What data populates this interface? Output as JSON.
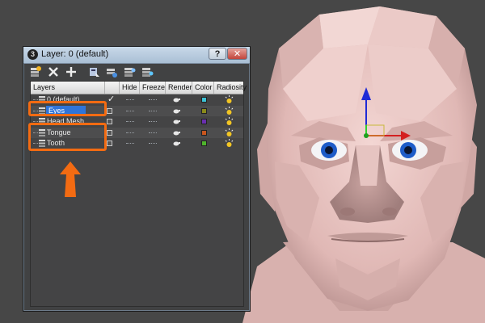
{
  "window": {
    "title": "Layer: 0 (default)",
    "help_label": "?",
    "close_label": "✕"
  },
  "toolbar": [
    {
      "name": "create-layer-icon"
    },
    {
      "name": "delete-layer-icon"
    },
    {
      "name": "add-to-layer-icon"
    },
    {
      "name": "select-in-layer-icon"
    },
    {
      "name": "highlight-layer-icon"
    },
    {
      "name": "hide-all-layers-icon"
    },
    {
      "name": "freeze-all-layers-icon"
    }
  ],
  "columns": [
    "Layers",
    "",
    "Hide",
    "Freeze",
    "Render",
    "Color",
    "Radiosity"
  ],
  "layers": [
    {
      "name": "0 (default)",
      "active": true,
      "selected": false,
      "color": "#3cc3d6"
    },
    {
      "name": "Eyes",
      "active": false,
      "selected": true,
      "color": "#8a8a1a"
    },
    {
      "name": "Head Mesh",
      "active": false,
      "selected": false,
      "color": "#6a2fb0"
    },
    {
      "name": "Tongue",
      "active": false,
      "selected": false,
      "color": "#c8561e"
    },
    {
      "name": "Tooth",
      "active": false,
      "selected": false,
      "color": "#4fb52c"
    }
  ],
  "colors": {
    "highlight": "#f36b12",
    "selection": "#2f74d8",
    "skin": "#e8c3c0",
    "iris": "#1e5cc8"
  }
}
